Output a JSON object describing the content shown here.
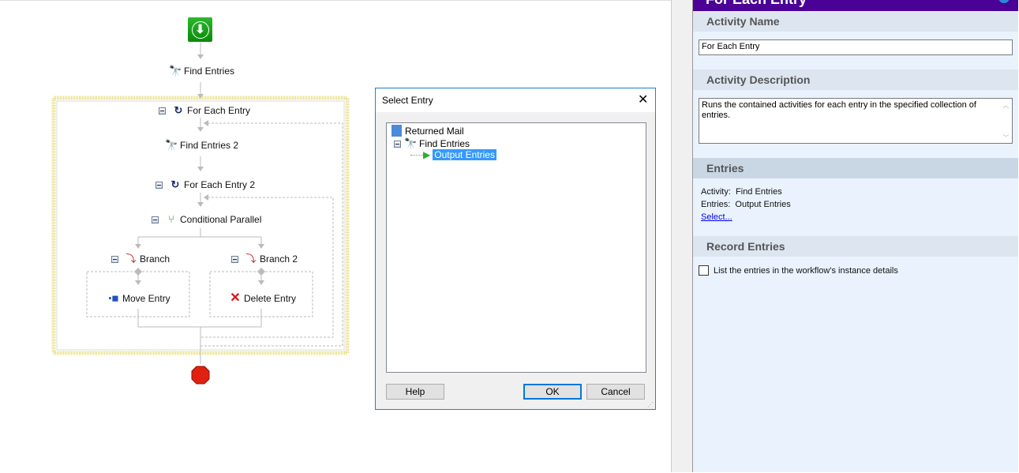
{
  "workflow": {
    "nodes": {
      "find_entries": "Find Entries",
      "for_each_entry": "For Each Entry",
      "find_entries_2": "Find Entries 2",
      "for_each_entry_2": "For Each Entry 2",
      "conditional_parallel": "Conditional Parallel",
      "branch": "Branch",
      "branch_2": "Branch 2",
      "move_entry": "Move Entry",
      "delete_entry": "Delete Entry"
    }
  },
  "dialog": {
    "title": "Select Entry",
    "tree": {
      "root": "Returned Mail",
      "child": "Find Entries",
      "leaf": "Output Entries"
    },
    "help": "Help",
    "ok": "OK",
    "cancel": "Cancel"
  },
  "panel": {
    "title": "For Each Entry",
    "activity_name_header": "Activity Name",
    "activity_name_value": "For Each Entry",
    "activity_description_header": "Activity Description",
    "activity_description_value": "Runs the contained activities for each entry in the specified collection of entries.",
    "entries_header": "Entries",
    "activity_label": "Activity:",
    "activity_value": "Find Entries",
    "entries_label": "Entries:",
    "entries_value": "Output Entries",
    "select_link": "Select...",
    "record_entries_header": "Record Entries",
    "record_checkbox_label": "List the entries in the workflow's instance details",
    "record_checked": false
  },
  "colors": {
    "panel_title": "#4b0096",
    "selection": "#3399ff",
    "accent_border": "#1883d7"
  }
}
